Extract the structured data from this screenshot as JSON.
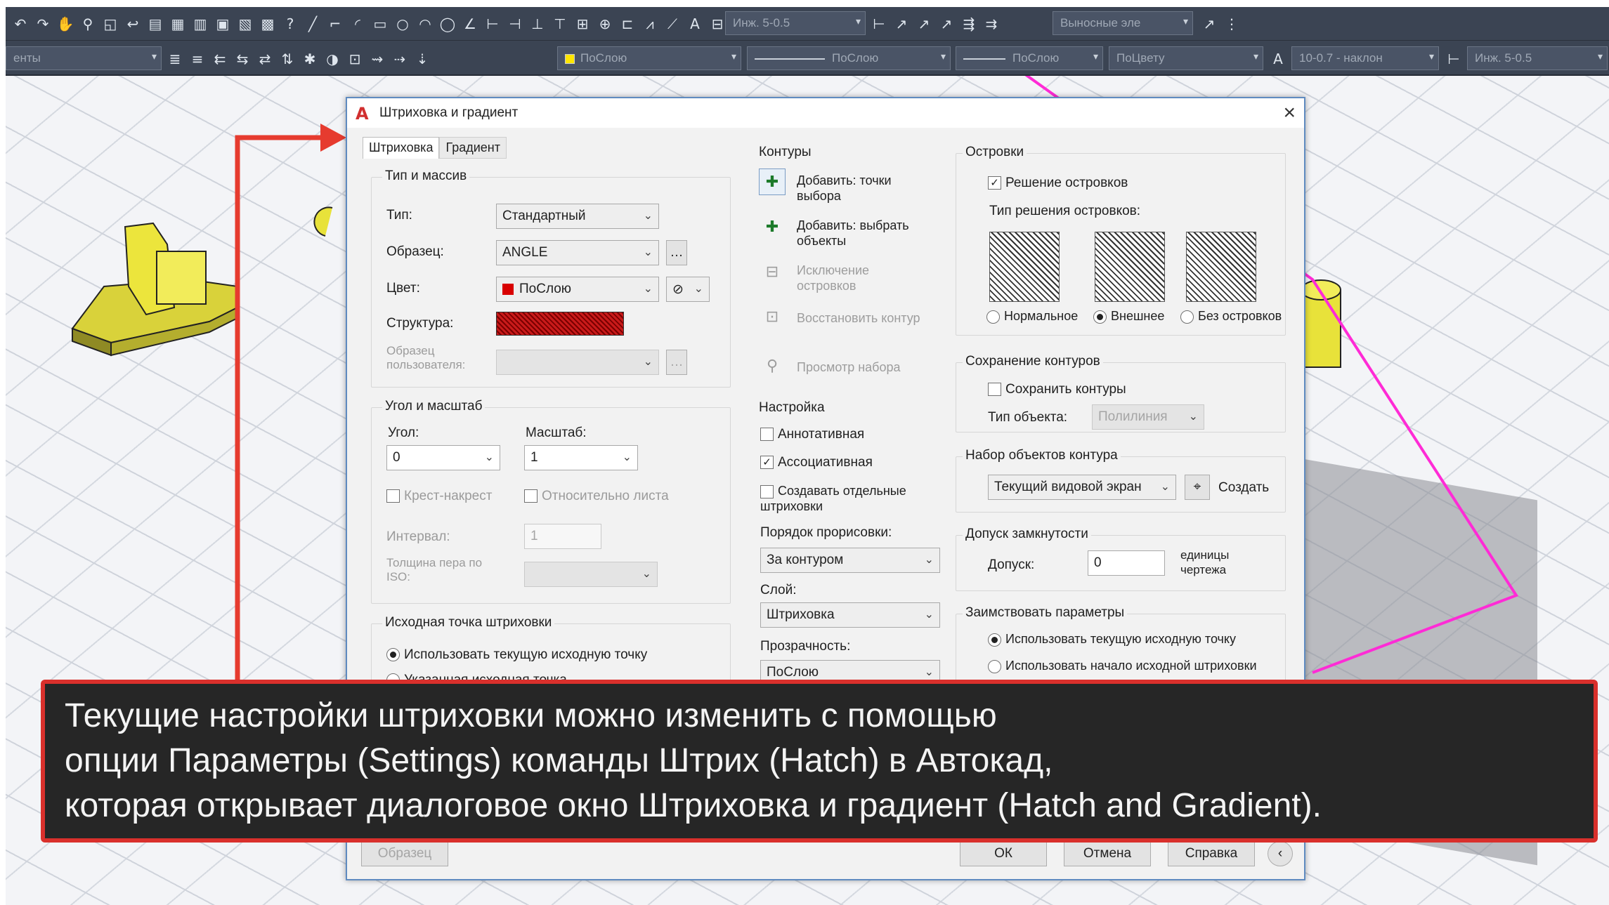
{
  "toolbar": {
    "combos1": [
      "Инж. 5-0.5",
      "Выносные эле"
    ],
    "left_stub": "енты",
    "combos2": [
      "ПоСлою",
      "ПоСлою",
      "ПоСлою",
      "ПоЦвету",
      "10-0.7 - наклон",
      "Инж. 5-0.5"
    ]
  },
  "dialog": {
    "title": "Штриховка и градиент",
    "tabs": [
      "Штриховка",
      "Градиент"
    ],
    "type_group": {
      "legend": "Тип и массив",
      "type_label": "Тип:",
      "type_value": "Стандартный",
      "pattern_label": "Образец:",
      "pattern_value": "ANGLE",
      "color_label": "Цвет:",
      "color_value": "ПоСлою",
      "swatch_label": "Структура:",
      "custom_label": "Образец пользователя:"
    },
    "angle_group": {
      "legend": "Угол и масштаб",
      "angle_label": "Угол:",
      "angle_value": "0",
      "scale_label": "Масштаб:",
      "scale_value": "1",
      "cross": "Крест-накрест",
      "relative": "Относительно листа",
      "spacing_label": "Интервал:",
      "spacing_value": "1",
      "iso_label": "Толщина пера по ISO:"
    },
    "origin_group": {
      "legend": "Исходная точка штриховки",
      "use_current": "Использовать текущую исходную точку",
      "specified": "Указанная исходная точка"
    },
    "boundaries": {
      "legend": "Контуры",
      "add_pick": "Добавить: точки выбора",
      "add_select": "Добавить: выбрать объекты",
      "remove": "Исключение островков",
      "recreate": "Восстановить контур",
      "view": "Просмотр набора"
    },
    "options": {
      "legend": "Настройка",
      "annotative": "Аннотативная",
      "associative": "Ассоциативная",
      "separate": "Создавать отдельные штриховки",
      "draw_order_label": "Порядок прорисовки:",
      "draw_order": "За контуром",
      "layer_label": "Слой:",
      "layer": "Штриховка",
      "transparency_label": "Прозрачность:",
      "transparency": "ПоСлою"
    },
    "islands": {
      "legend": "Островки",
      "detect": "Решение островков",
      "style_label": "Тип решения островков:",
      "normal": "Нормальное",
      "outer": "Внешнее",
      "ignore": "Без островков"
    },
    "retain": {
      "legend": "Сохранение контуров",
      "retain_cb": "Сохранить контуры",
      "object_type_label": "Тип объекта:",
      "object_type": "Полилиния"
    },
    "boundary_set": {
      "legend": "Набор объектов контура",
      "value": "Текущий видовой экран",
      "new_label": "Создать"
    },
    "gap": {
      "legend": "Допуск замкнутости",
      "label": "Допуск:",
      "value": "0",
      "units": "единицы чертежа"
    },
    "inherit": {
      "legend": "Заимствовать параметры",
      "current": "Использовать текущую исходную точку",
      "source": "Использовать начало исходной штриховки"
    },
    "buttons": {
      "preview": "Образец",
      "ok": "ОК",
      "cancel": "Отмена",
      "help": "Справка"
    }
  },
  "caption": {
    "line1": "Текущие настройки штриховки можно изменить с помощью",
    "line2": "опции Параметры (Settings) команды Штрих (Hatch) в Автокад,",
    "line3": "которая открывает диалоговое окно Штриховка и градиент (Hatch and Gradient)."
  },
  "colors": {
    "accent_red": "#d9302c",
    "title_border": "#5f8bc0",
    "model_yellow": "#e8e23a",
    "highlight_magenta": "#ff2bd6"
  }
}
